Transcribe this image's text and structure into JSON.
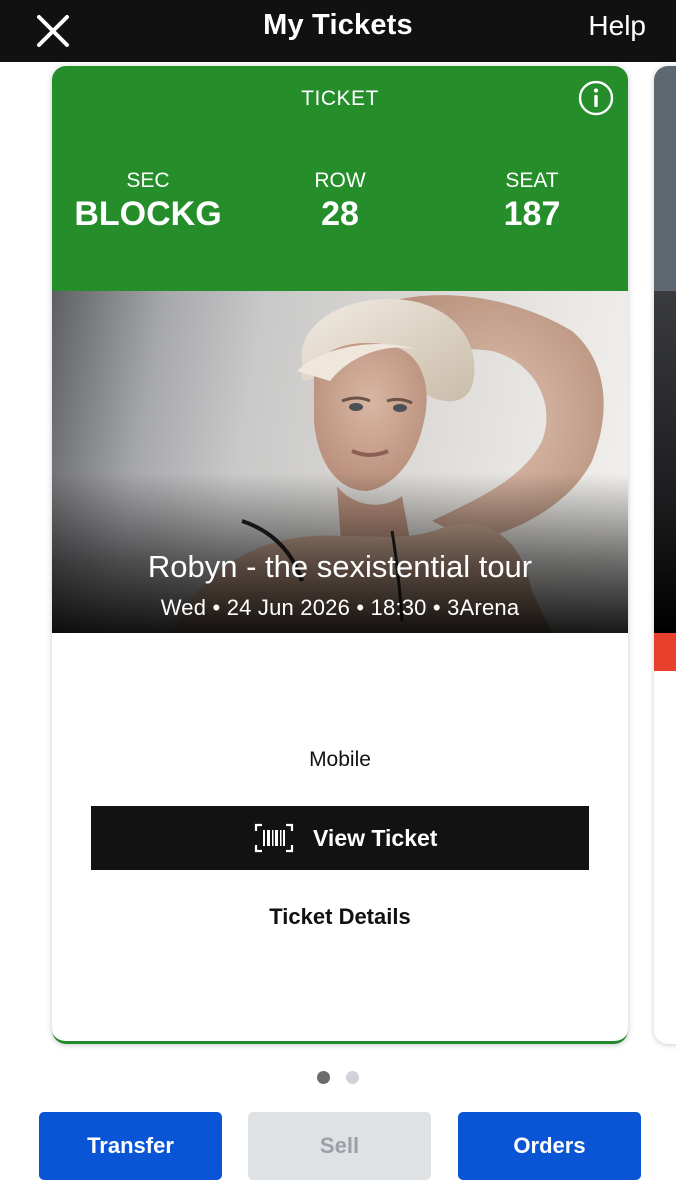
{
  "header": {
    "title": "My Tickets",
    "help_label": "Help",
    "close_icon": "close-icon"
  },
  "ticket": {
    "label": "TICKET",
    "info_icon": "info-icon",
    "section_label": "SEC",
    "section_value": "BLOCKG",
    "row_label": "ROW",
    "row_value": "28",
    "seat_label": "SEAT",
    "seat_value": "187",
    "event_name": "Robyn - the sexistential tour",
    "event_info": "Wed • 24 Jun 2026 • 18:30 • 3Arena",
    "delivery_method": "Mobile",
    "view_ticket_label": "View Ticket",
    "barcode_icon": "barcode-icon",
    "details_label": "Ticket Details",
    "header_color": "#258e2b"
  },
  "pager": {
    "count": 2,
    "active_index": 0
  },
  "actions": {
    "transfer_label": "Transfer",
    "sell_label": "Sell",
    "orders_label": "Orders",
    "primary_color": "#0a55d6"
  }
}
